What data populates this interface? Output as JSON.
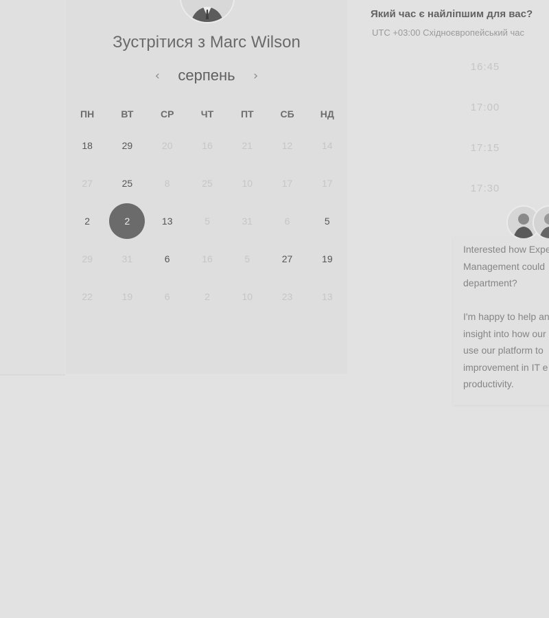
{
  "calendar": {
    "title_prefix": "Зустрітися з",
    "host_name": "Marc Wilson",
    "month": "серпень",
    "prev_icon": "chevron-left-icon",
    "next_icon": "chevron-right-icon",
    "weekdays": [
      "ПН",
      "ВТ",
      "СР",
      "ЧТ",
      "ПТ",
      "СБ",
      "НД"
    ],
    "weeks": [
      [
        {
          "d": "18",
          "on": true
        },
        {
          "d": "29",
          "on": true
        },
        {
          "d": "20",
          "on": false
        },
        {
          "d": "16",
          "on": false
        },
        {
          "d": "21",
          "on": false
        },
        {
          "d": "12",
          "on": false
        },
        {
          "d": "14",
          "on": false
        }
      ],
      [
        {
          "d": "27",
          "on": false
        },
        {
          "d": "25",
          "on": true
        },
        {
          "d": "8",
          "on": false
        },
        {
          "d": "25",
          "on": false
        },
        {
          "d": "10",
          "on": false
        },
        {
          "d": "17",
          "on": false
        },
        {
          "d": "17",
          "on": false
        }
      ],
      [
        {
          "d": "2",
          "on": true
        },
        {
          "d": "2",
          "on": true,
          "selected": true
        },
        {
          "d": "13",
          "on": true
        },
        {
          "d": "5",
          "on": false
        },
        {
          "d": "31",
          "on": false
        },
        {
          "d": "6",
          "on": false
        },
        {
          "d": "5",
          "on": true
        }
      ],
      [
        {
          "d": "29",
          "on": false
        },
        {
          "d": "31",
          "on": false
        },
        {
          "d": "6",
          "on": true
        },
        {
          "d": "16",
          "on": false
        },
        {
          "d": "5",
          "on": false
        },
        {
          "d": "27",
          "on": true
        },
        {
          "d": "19",
          "on": true
        }
      ],
      [
        {
          "d": "22",
          "on": false
        },
        {
          "d": "19",
          "on": false
        },
        {
          "d": "6",
          "on": false
        },
        {
          "d": "2",
          "on": false
        },
        {
          "d": "10",
          "on": false
        },
        {
          "d": "23",
          "on": false
        },
        {
          "d": "13",
          "on": false
        }
      ]
    ],
    "selected_color": "#6b6b6b"
  },
  "times": {
    "title": "Який час є найліпшим для вас?",
    "timezone": "UTC +03:00 Східноєвропейський час",
    "slots": [
      "16:45",
      "17:00",
      "17:15",
      "17:30"
    ]
  },
  "message": {
    "paragraph1": [
      "Interested how Expe",
      "Management could",
      "department?"
    ],
    "paragraph2": [
      "I'm happy to help an",
      "insight into how our",
      "use our platform to",
      "improvement in IT e",
      "productivity."
    ]
  }
}
